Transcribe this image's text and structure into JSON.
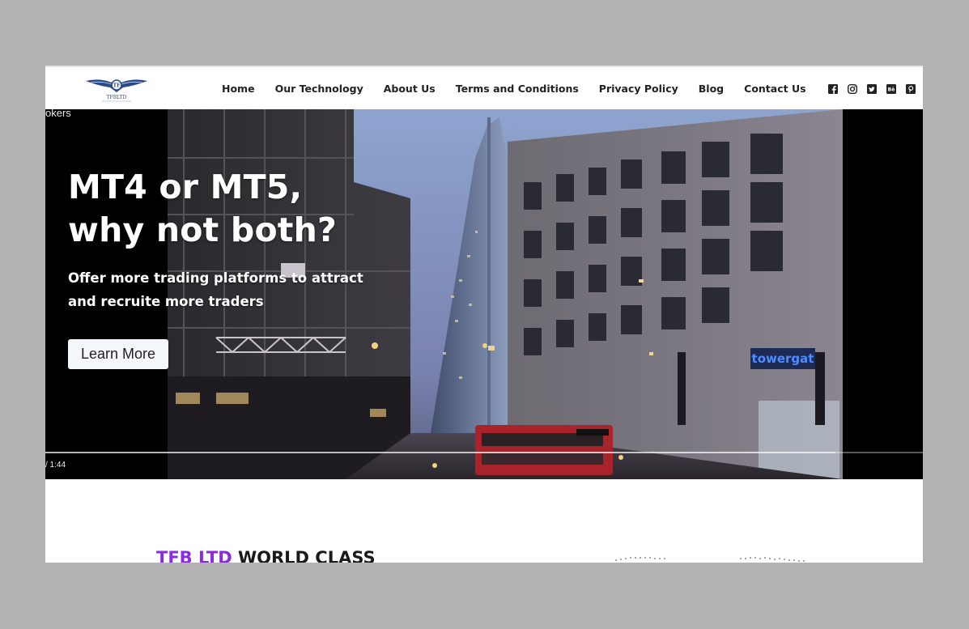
{
  "header": {
    "logo_text": "TFBLTD",
    "nav": [
      {
        "label": "Home"
      },
      {
        "label": "Our Technology"
      },
      {
        "label": "About Us"
      },
      {
        "label": "Terms and Conditions"
      },
      {
        "label": "Privacy Policy"
      },
      {
        "label": "Blog"
      },
      {
        "label": "Contact Us"
      }
    ],
    "social": [
      "facebook-icon",
      "instagram-icon",
      "twitter-icon",
      "behance-icon",
      "pinterest-icon"
    ]
  },
  "hero": {
    "video_caption": "okers",
    "title_line1": "MT4 or MT5,",
    "title_line2": "why not both?",
    "subtitle_line1": "Offer more trading platforms to attract",
    "subtitle_line2": "and recruite more traders",
    "cta_label": "Learn More",
    "video_time": "/ 1:44",
    "progress": 0.9
  },
  "section": {
    "title_accent": "TFB LTD",
    "title_rest": " WORLD CLASS"
  },
  "colors": {
    "accent": "#8a2be2",
    "nav_text": "#222222",
    "background": "#b3b3b3"
  }
}
